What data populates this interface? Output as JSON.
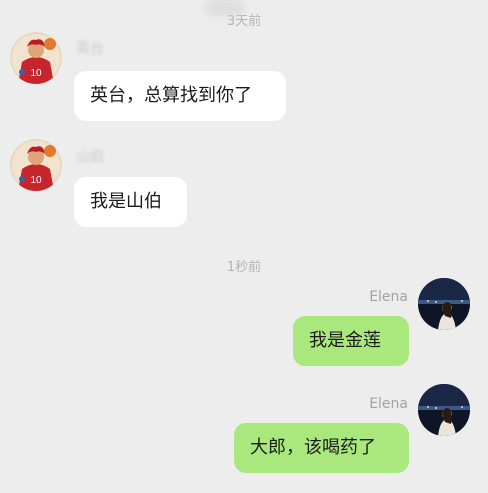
{
  "chat": {
    "timestamps": {
      "top": "3天前",
      "middle": "1秒前"
    },
    "messages": [
      {
        "side": "in",
        "sender": "英台",
        "avatar_icon": "basketball-player-avatar-icon",
        "text": "英台，总算找到你了"
      },
      {
        "side": "in",
        "sender": "山伯",
        "avatar_icon": "basketball-player-avatar-icon",
        "text": "我是山伯"
      },
      {
        "side": "out",
        "sender": "Elena",
        "avatar_icon": "night-sea-portrait-avatar-icon",
        "text": "我是金莲"
      },
      {
        "side": "out",
        "sender": "Elena",
        "avatar_icon": "night-sea-portrait-avatar-icon",
        "text": "大郎，该喝药了"
      }
    ]
  },
  "colors": {
    "background": "#ededed",
    "incoming_bubble": "#ffffff",
    "outgoing_bubble": "#a9e87c",
    "meta_text": "#b3b3b3"
  }
}
